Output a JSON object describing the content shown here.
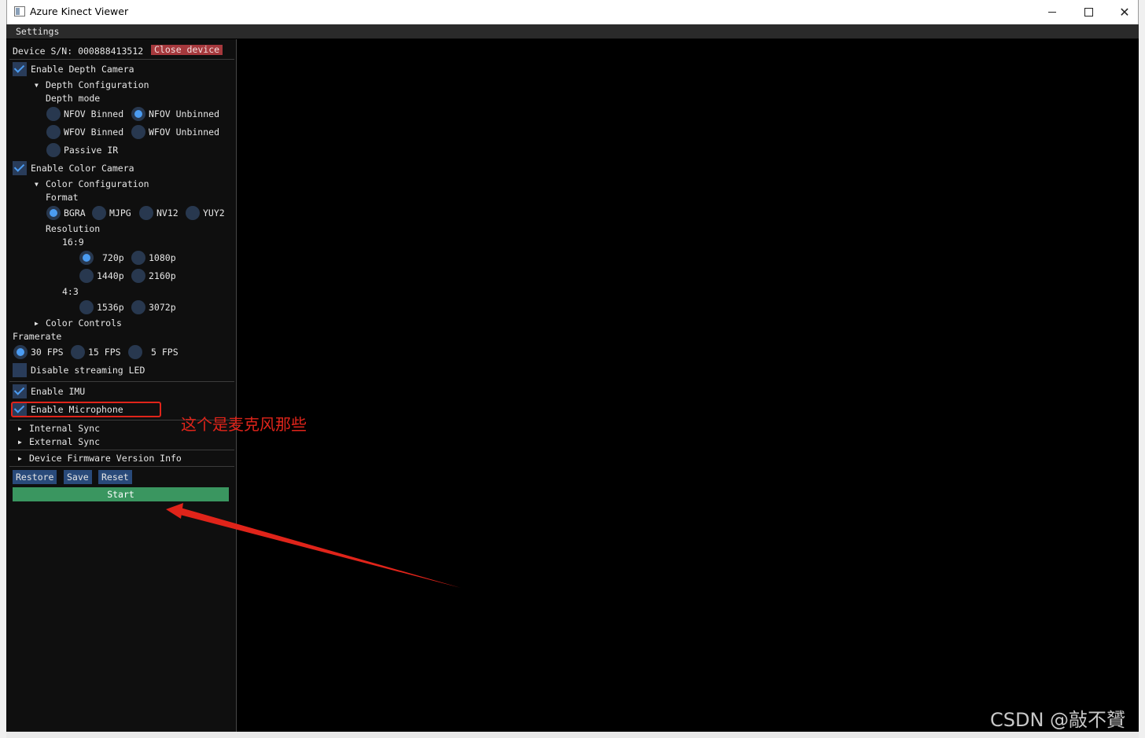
{
  "window": {
    "title": "Azure Kinect Viewer",
    "minimize_icon": "minimize-icon",
    "maximize_icon": "maximize-icon",
    "close_glyph": "✕"
  },
  "menu": {
    "settings": "Settings"
  },
  "device": {
    "serial_label": "Device S/N: 000888413512",
    "close_button": "Close device"
  },
  "depth": {
    "enable_label": "Enable Depth Camera",
    "enabled": true,
    "config_header": "Depth Configuration",
    "mode_label": "Depth mode",
    "modes": [
      {
        "label": "NFOV Binned",
        "selected": false
      },
      {
        "label": "NFOV Unbinned",
        "selected": true
      },
      {
        "label": "WFOV Binned",
        "selected": false
      },
      {
        "label": "WFOV Unbinned",
        "selected": false
      },
      {
        "label": "Passive IR",
        "selected": false
      }
    ]
  },
  "color": {
    "enable_label": "Enable Color Camera",
    "enabled": true,
    "config_header": "Color Configuration",
    "format_label": "Format",
    "formats": [
      {
        "label": "BGRA",
        "selected": true
      },
      {
        "label": "MJPG",
        "selected": false
      },
      {
        "label": "NV12",
        "selected": false
      },
      {
        "label": "YUY2",
        "selected": false
      }
    ],
    "resolution_label": "Resolution",
    "aspect_16_9": "16:9",
    "res_16_9": [
      {
        "label": "720p",
        "selected": true
      },
      {
        "label": "1080p",
        "selected": false
      },
      {
        "label": "1440p",
        "selected": false
      },
      {
        "label": "2160p",
        "selected": false
      }
    ],
    "aspect_4_3": "4:3",
    "res_4_3": [
      {
        "label": "1536p",
        "selected": false
      },
      {
        "label": "3072p",
        "selected": false
      }
    ],
    "controls_header": "Color Controls"
  },
  "framerate": {
    "label": "Framerate",
    "options": [
      {
        "label": "30 FPS",
        "selected": true
      },
      {
        "label": "15 FPS",
        "selected": false
      },
      {
        "label": "5 FPS",
        "selected": false
      }
    ]
  },
  "led": {
    "label": "Disable streaming LED",
    "checked": false
  },
  "imu": {
    "label": "Enable IMU",
    "checked": true
  },
  "microphone": {
    "label": "Enable Microphone",
    "checked": true
  },
  "sync": {
    "internal": "Internal Sync",
    "external": "External Sync"
  },
  "firmware": {
    "label": "Device Firmware Version Info"
  },
  "actions": {
    "restore": "Restore",
    "save": "Save",
    "reset": "Reset",
    "start": "Start"
  },
  "annotation": {
    "text": "这个是麦克风那些",
    "color": "#e0241a"
  },
  "watermark": "CSDN @敲不贇",
  "colors": {
    "panel_bg": "#0f0f0f",
    "accent": "#4b9cf2",
    "close_button": "#a6393d",
    "start_button": "#3a9660",
    "button": "#294a7a"
  }
}
